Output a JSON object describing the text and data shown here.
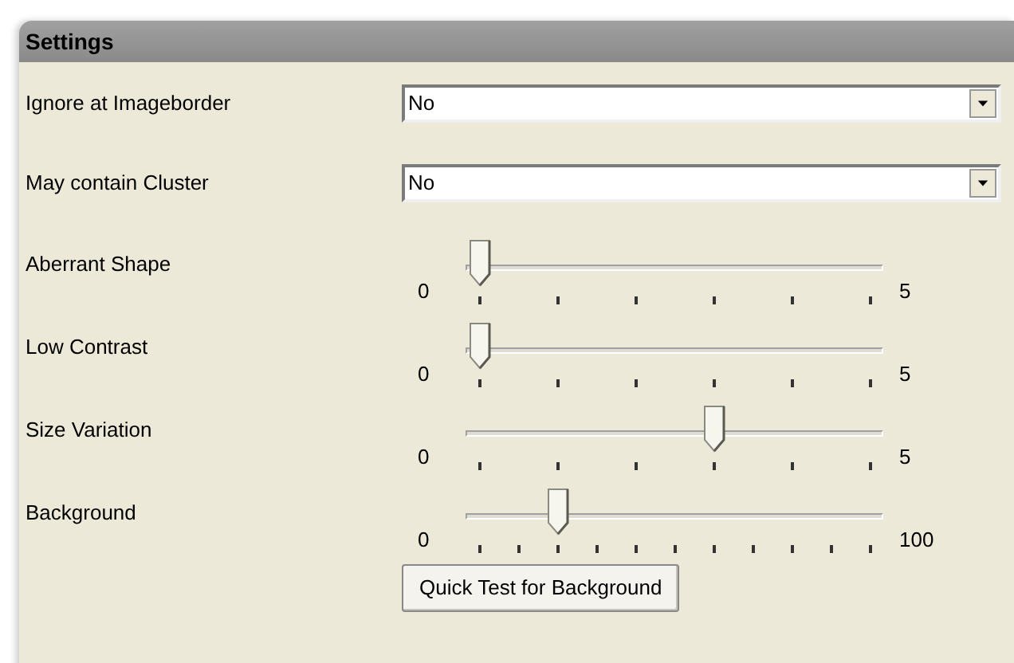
{
  "panel": {
    "title": "Settings"
  },
  "dropdowns": [
    {
      "label": "Ignore at Imageborder",
      "value": "No"
    },
    {
      "label": "May contain Cluster",
      "value": "No"
    }
  ],
  "sliders": [
    {
      "label": "Aberrant Shape",
      "kind": "steps",
      "level": 0,
      "min": "0",
      "max": "5"
    },
    {
      "label": "Low Contrast",
      "kind": "steps",
      "level": 0,
      "min": "0",
      "max": "5"
    },
    {
      "label": "Size Variation",
      "kind": "steps",
      "level": 0.6,
      "min": "0",
      "max": "5"
    },
    {
      "label": "Background",
      "kind": "percent",
      "level": 0.2,
      "min": "0",
      "max": "100"
    }
  ],
  "button": {
    "label": "Quick Test for Background"
  }
}
